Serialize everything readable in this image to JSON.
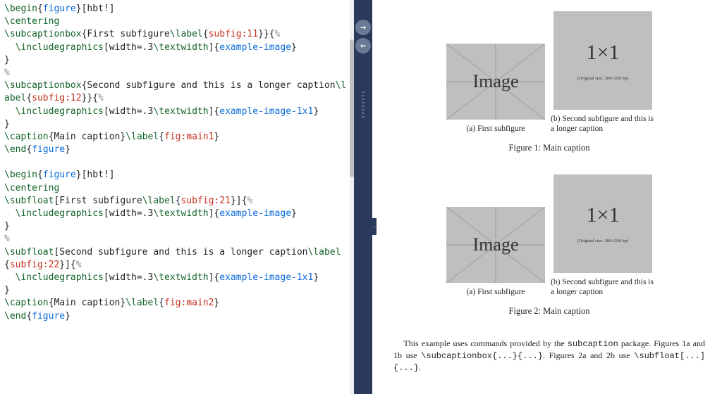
{
  "editor": {
    "lines": [
      [
        [
          "\\begin",
          "green"
        ],
        [
          "{",
          "plain"
        ],
        [
          "figure",
          "blue"
        ],
        [
          "}[hbt!]",
          "plain"
        ]
      ],
      [
        [
          "\\centering",
          "green"
        ]
      ],
      [
        [
          "\\subcaptionbox",
          "green"
        ],
        [
          "{First subfigure",
          "plain"
        ],
        [
          "\\label",
          "green"
        ],
        [
          "{",
          "plain"
        ],
        [
          "subfig:11",
          "red"
        ],
        [
          "}}{",
          "plain"
        ],
        [
          "%",
          "gray"
        ]
      ],
      [
        [
          "  ",
          "plain"
        ],
        [
          "\\includegraphics",
          "green"
        ],
        [
          "[width=.3",
          "plain"
        ],
        [
          "\\textwidth",
          "green"
        ],
        [
          "]{",
          "plain"
        ],
        [
          "example-image",
          "blue"
        ],
        [
          "}",
          "plain"
        ]
      ],
      [
        [
          "}",
          "plain"
        ]
      ],
      [
        [
          "%",
          "gray"
        ]
      ],
      [
        [
          "\\subcaptionbox",
          "green"
        ],
        [
          "{Second subfigure and this is a longer caption",
          "plain"
        ],
        [
          "\\label",
          "green"
        ],
        [
          "{",
          "plain"
        ],
        [
          "subfig:12",
          "red"
        ],
        [
          "}}{",
          "plain"
        ],
        [
          "%",
          "gray"
        ]
      ],
      [
        [
          "  ",
          "plain"
        ],
        [
          "\\includegraphics",
          "green"
        ],
        [
          "[width=.3",
          "plain"
        ],
        [
          "\\textwidth",
          "green"
        ],
        [
          "]{",
          "plain"
        ],
        [
          "example-image-1x1",
          "blue"
        ],
        [
          "}",
          "plain"
        ]
      ],
      [
        [
          "}",
          "plain"
        ]
      ],
      [
        [
          "\\caption",
          "green"
        ],
        [
          "{Main caption}",
          "plain"
        ],
        [
          "\\label",
          "green"
        ],
        [
          "{",
          "plain"
        ],
        [
          "fig:main1",
          "red"
        ],
        [
          "}",
          "plain"
        ]
      ],
      [
        [
          "\\end",
          "green"
        ],
        [
          "{",
          "plain"
        ],
        [
          "figure",
          "blue"
        ],
        [
          "}",
          "plain"
        ]
      ],
      [
        [
          "",
          "plain"
        ]
      ],
      [
        [
          "\\begin",
          "green"
        ],
        [
          "{",
          "plain"
        ],
        [
          "figure",
          "blue"
        ],
        [
          "}[hbt!]",
          "plain"
        ]
      ],
      [
        [
          "\\centering",
          "green"
        ]
      ],
      [
        [
          "\\subfloat",
          "green"
        ],
        [
          "[First subfigure",
          "plain"
        ],
        [
          "\\label",
          "green"
        ],
        [
          "{",
          "plain"
        ],
        [
          "subfig:21",
          "red"
        ],
        [
          "}]{",
          "plain"
        ],
        [
          "%",
          "gray"
        ]
      ],
      [
        [
          "  ",
          "plain"
        ],
        [
          "\\includegraphics",
          "green"
        ],
        [
          "[width=.3",
          "plain"
        ],
        [
          "\\textwidth",
          "green"
        ],
        [
          "]{",
          "plain"
        ],
        [
          "example-image",
          "blue"
        ],
        [
          "}",
          "plain"
        ]
      ],
      [
        [
          "}",
          "plain"
        ]
      ],
      [
        [
          "%",
          "gray"
        ]
      ],
      [
        [
          "\\subfloat",
          "green"
        ],
        [
          "[Second subfigure and this is a longer caption",
          "plain"
        ],
        [
          "\\label",
          "green"
        ],
        [
          "{",
          "plain"
        ],
        [
          "subfig:22",
          "red"
        ],
        [
          "}]{",
          "plain"
        ],
        [
          "%",
          "gray"
        ]
      ],
      [
        [
          "  ",
          "plain"
        ],
        [
          "\\includegraphics",
          "green"
        ],
        [
          "[width=.3",
          "plain"
        ],
        [
          "\\textwidth",
          "green"
        ],
        [
          "]{",
          "plain"
        ],
        [
          "example-image-1x1",
          "blue"
        ],
        [
          "}",
          "plain"
        ]
      ],
      [
        [
          "}",
          "plain"
        ]
      ],
      [
        [
          "\\caption",
          "green"
        ],
        [
          "{Main caption}",
          "plain"
        ],
        [
          "\\label",
          "green"
        ],
        [
          "{",
          "plain"
        ],
        [
          "fig:main2",
          "red"
        ],
        [
          "}",
          "plain"
        ]
      ],
      [
        [
          "\\end",
          "green"
        ],
        [
          "{",
          "plain"
        ],
        [
          "figure",
          "blue"
        ],
        [
          "}",
          "plain"
        ]
      ]
    ]
  },
  "preview": {
    "figures": [
      {
        "subfigs": [
          {
            "label": "(a) First subfigure",
            "type": "image"
          },
          {
            "label": "(b)  Second  subfigure  and this is a longer caption",
            "type": "onebyone"
          }
        ],
        "caption": "Figure 1:  Main caption"
      },
      {
        "subfigs": [
          {
            "label": "(a) First subfigure",
            "type": "image"
          },
          {
            "label": "(b)  Second  subfigure  and this is a longer caption",
            "type": "onebyone"
          }
        ],
        "caption": "Figure 2:  Main caption"
      }
    ],
    "img_placeholder": "Image",
    "one_big": "1×1",
    "one_small": "(Original size: 200×200 bp)",
    "paragraph_parts": {
      "p1a": "This example uses commands provided by the ",
      "p1b": "subcaption",
      "p1c": " package.  Figures 1a and 1b use ",
      "p1d": "\\subcaptionbox{...}{...}",
      "p1e": ". Figures 2a and 2b use ",
      "p1f": "\\subfloat[...]{...}",
      "p1g": "."
    }
  },
  "nav": {
    "fwd": "→",
    "back": "←",
    "expand": "›"
  }
}
